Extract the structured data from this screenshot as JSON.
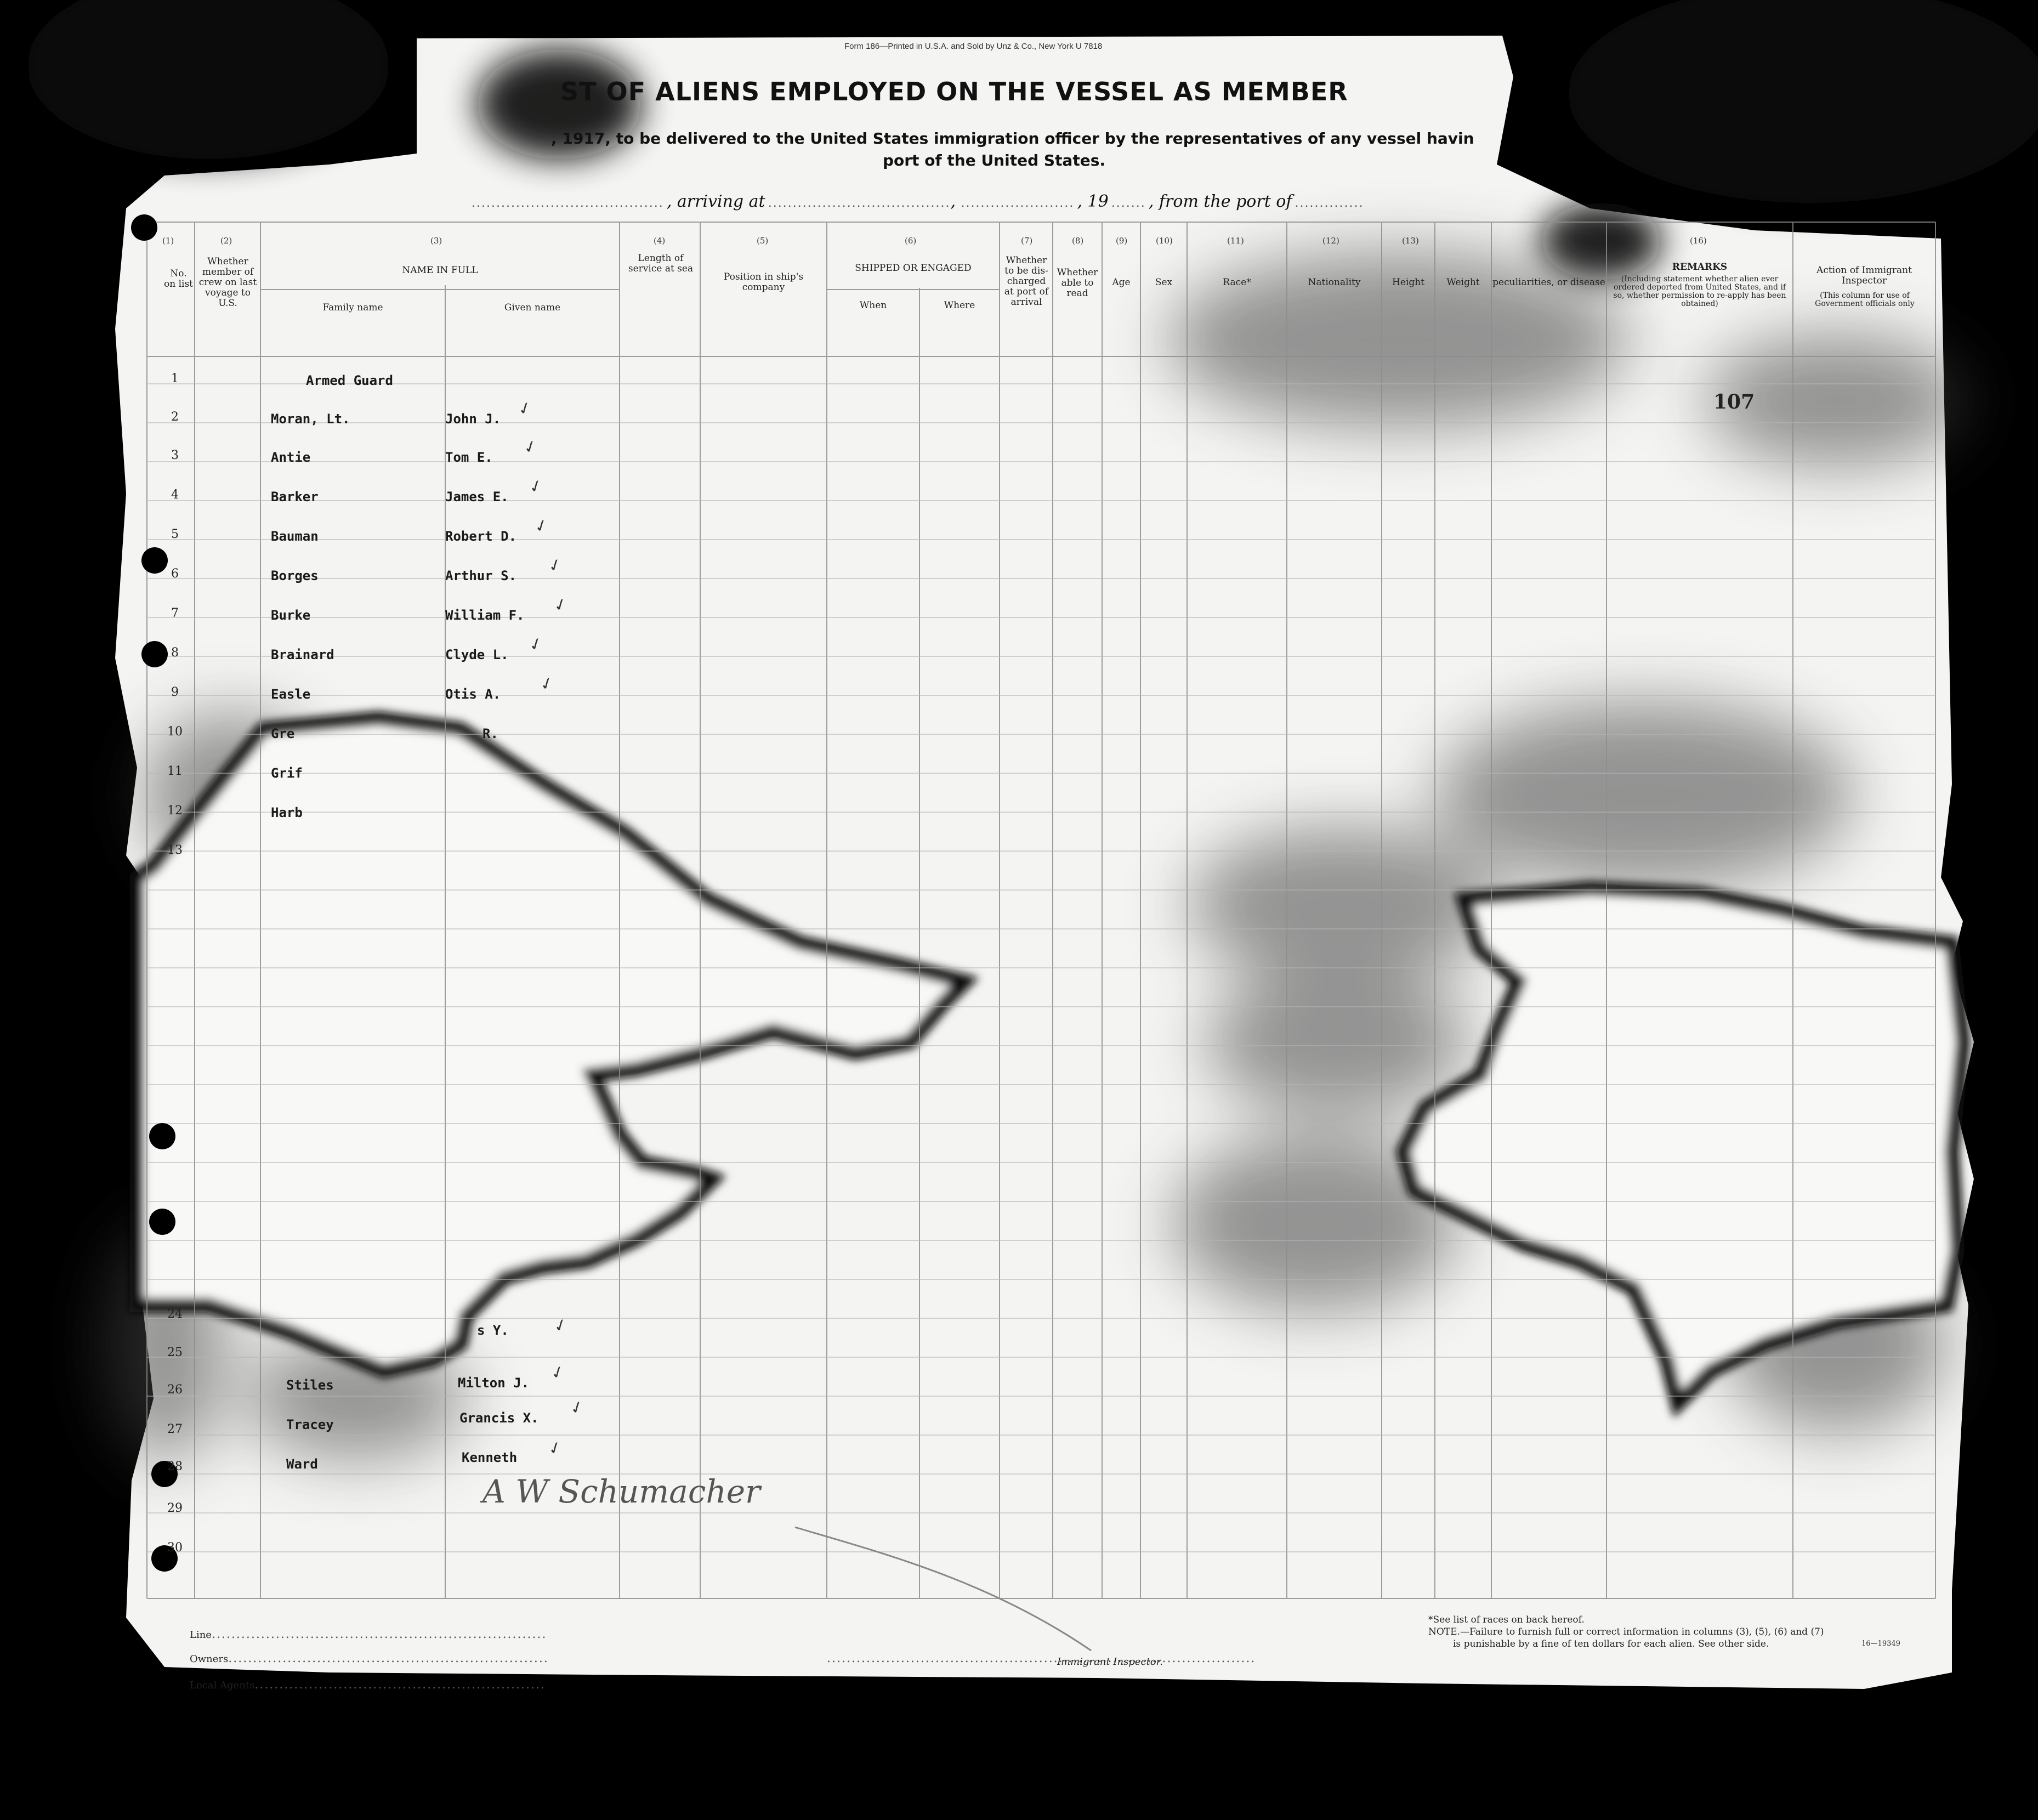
{
  "form": {
    "printer_line": "Form 186—Printed in U.S.A. and Sold by Unz & Co., New York U 7818",
    "title": "ST OF ALIENS EMPLOYED ON THE VESSEL AS MEMBER",
    "subtitle_1": ", 1917, to be delivered to the United States immigration officer by the representatives of any vessel havin",
    "subtitle_2": "port of the United States.",
    "arriving_at": ", arriving at",
    "year": ", 19",
    "from_port": ", from the port of",
    "page_number": "107"
  },
  "columns": {
    "numbers": [
      "(1)",
      "(2)",
      "(3)",
      "(4)",
      "(5)",
      "(6)",
      "(7)",
      "(8)",
      "(9)",
      "(10)",
      "(11)",
      "(12)",
      "(13)",
      "(16)"
    ],
    "no_on_list": "No. on list",
    "member_of_crew": "Whether member of crew on last voyage to U.S.",
    "name_in_full": "NAME IN FULL",
    "family_name": "Family name",
    "given_name": "Given name",
    "length_of_service": "Length of service at sea",
    "position": "Position in ship's company",
    "shipped_or_engaged": "SHIPPED OR ENGAGED",
    "when": "When",
    "where": "Where",
    "discharged": "Whether to be dis- charged at port of arrival",
    "able_to_read": "Whether able to read",
    "age": "Age",
    "sex": "Sex",
    "race": "Race*",
    "nationality": "Nationality",
    "height": "Height",
    "weight": "Weight",
    "peculiarities": "peculiarities, or disease",
    "remarks": "REMARKS",
    "remarks_note": "(Including statement whether alien ever ordered deported from United States, and if so, whether permission to re-apply has been obtained)",
    "action": "Action of Immigrant Inspector",
    "action_note": "(This column for use of Government officials only"
  },
  "rows": [
    {
      "no": "1",
      "family": "Armed Guard",
      "given": ""
    },
    {
      "no": "2",
      "family": "Moran, Lt.",
      "given": "John J."
    },
    {
      "no": "3",
      "family": "Antie",
      "given": "Tom E."
    },
    {
      "no": "4",
      "family": "Barker",
      "given": "James E."
    },
    {
      "no": "5",
      "family": "Bauman",
      "given": "Robert D."
    },
    {
      "no": "6",
      "family": "Borges",
      "given": "Arthur S."
    },
    {
      "no": "7",
      "family": "Burke",
      "given": "William F."
    },
    {
      "no": "8",
      "family": "Brainard",
      "given": "Clyde L."
    },
    {
      "no": "9",
      "family": "Easle",
      "given": "Otis A."
    },
    {
      "no": "10",
      "family": "Gre",
      "given": "R."
    },
    {
      "no": "11",
      "family": "Grif",
      "given": ""
    },
    {
      "no": "12",
      "family": "Harb",
      "given": ""
    },
    {
      "no": "13",
      "family": "",
      "given": ""
    },
    {
      "no": "24",
      "family": "",
      "given": ""
    },
    {
      "no": "25",
      "family": "",
      "given": "s Y."
    },
    {
      "no": "26",
      "family": "Stiles",
      "given": "Milton J."
    },
    {
      "no": "27",
      "family": "Tracey",
      "given": "Grancis X."
    },
    {
      "no": "28",
      "family": "Ward",
      "given": "Kenneth"
    },
    {
      "no": "29",
      "family": "",
      "given": ""
    },
    {
      "no": "30",
      "family": "",
      "given": ""
    }
  ],
  "signature": "A W Schumacher",
  "footer": {
    "line": "Line",
    "owners": "Owners",
    "local_agents": "Local Agents",
    "inspector": "Immigrant Inspector.",
    "races_note": "*See list of races on back hereof.",
    "note_1": "NOTE.—Failure to furnish full or correct information in columns (3), (5), (6) and (7)",
    "note_2": "is punishable by a fine of ten dollars for each alien. See other side.",
    "form_code": "16—19349"
  }
}
